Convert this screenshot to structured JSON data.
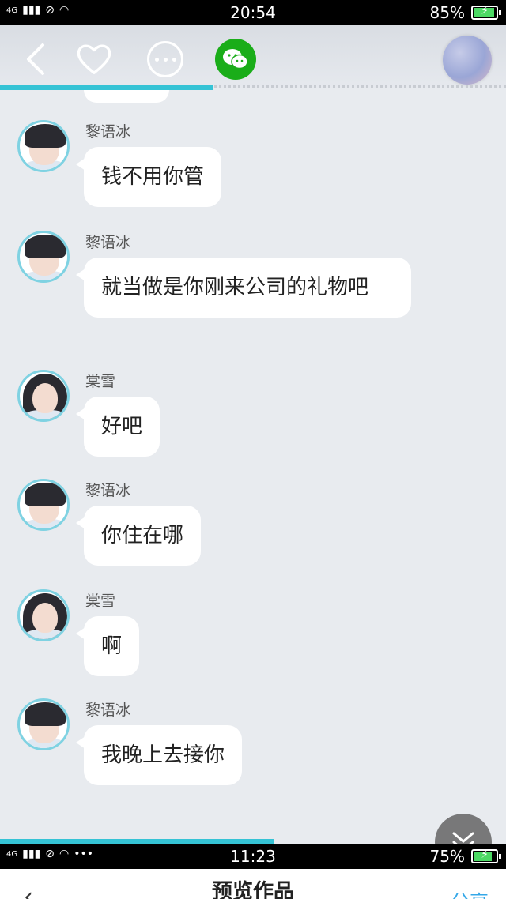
{
  "status_top": {
    "network": "4G",
    "time": "20:54",
    "battery": "85%"
  },
  "toolbar": {
    "back": "back",
    "like": "like",
    "more": "more",
    "share_wechat": "wechat"
  },
  "progress_top": 0.42,
  "messages": [
    {
      "sender": "黎语冰",
      "text": "钱不用你管",
      "avatar": "male"
    },
    {
      "sender": "黎语冰",
      "text": "就当做是你刚来公司的礼物吧",
      "avatar": "male"
    },
    {
      "sender": "棠雪",
      "text": "好吧",
      "avatar": "female"
    },
    {
      "sender": "黎语冰",
      "text": "你住在哪",
      "avatar": "male"
    },
    {
      "sender": "棠雪",
      "text": "啊",
      "avatar": "female"
    },
    {
      "sender": "黎语冰",
      "text": "我晚上去接你",
      "avatar": "male"
    }
  ],
  "progress_bottom": 0.54,
  "status_bottom": {
    "network": "4G",
    "time": "11:23",
    "battery": "75%"
  },
  "bottom_header": {
    "title": "预览作品",
    "share": "分享"
  },
  "colors": {
    "accent": "#35c3d5",
    "wechat": "#1aad19"
  }
}
